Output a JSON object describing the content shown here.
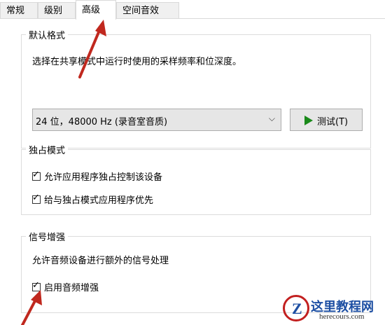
{
  "tabs": [
    {
      "label": "常规",
      "active": false
    },
    {
      "label": "级别",
      "active": false
    },
    {
      "label": "高级",
      "active": true
    },
    {
      "label": "空间音效",
      "active": false
    }
  ],
  "default_format": {
    "legend": "默认格式",
    "description": "选择在共享模式中运行时使用的采样频率和位深度。",
    "selected_value": "24 位，48000 Hz (录音室音质)",
    "test_button_label": "测试(T)"
  },
  "exclusive_mode": {
    "legend": "独占模式",
    "options": [
      {
        "label": "允许应用程序独占控制该设备",
        "checked": true
      },
      {
        "label": "给与独占模式应用程序优先",
        "checked": true
      }
    ]
  },
  "signal_enhancement": {
    "legend": "信号增强",
    "description": "允许音频设备进行额外的信号处理",
    "option": {
      "label": "启用音频增强",
      "checked": true
    }
  },
  "watermark": {
    "title": "这里教程网",
    "url": "herecours.com"
  },
  "colors": {
    "arrow": "#c0281e",
    "play_icon": "#1a8a1a",
    "watermark_blue": "#1d4fa3",
    "watermark_red": "#c21f1f"
  }
}
